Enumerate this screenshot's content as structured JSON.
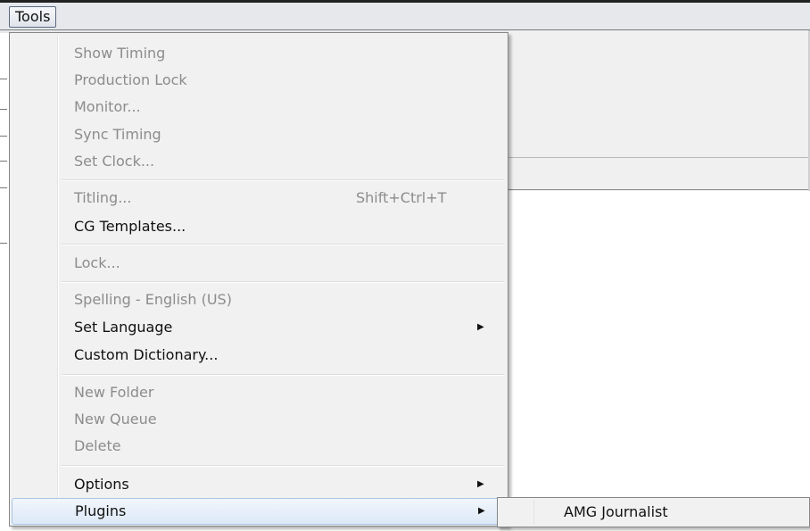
{
  "menubar": {
    "tools_label": "Tools"
  },
  "menu": {
    "groups": [
      [
        {
          "label": "Show Timing",
          "enabled": false
        },
        {
          "label": "Production Lock",
          "enabled": false
        },
        {
          "label": "Monitor...",
          "enabled": false
        },
        {
          "label": "Sync Timing",
          "enabled": false
        },
        {
          "label": "Set Clock...",
          "enabled": false
        }
      ],
      [
        {
          "label": "Titling...",
          "shortcut": "Shift+Ctrl+T",
          "enabled": false
        },
        {
          "label": "CG Templates...",
          "enabled": true
        }
      ],
      [
        {
          "label": "Lock...",
          "enabled": false
        }
      ],
      [
        {
          "label": "Spelling - English (US)",
          "enabled": false
        },
        {
          "label": "Set Language",
          "enabled": true,
          "submenu_arrow": "▶"
        },
        {
          "label": "Custom Dictionary...",
          "enabled": true
        }
      ],
      [
        {
          "label": "New Folder",
          "enabled": false
        },
        {
          "label": "New Queue",
          "enabled": false
        },
        {
          "label": "Delete",
          "enabled": false
        }
      ],
      [
        {
          "label": "Options",
          "enabled": true,
          "submenu_arrow": "▶"
        },
        {
          "label": "Plugins",
          "enabled": true,
          "submenu_arrow": "▶",
          "highlighted": true
        }
      ]
    ]
  },
  "submenu": {
    "items": [
      {
        "label": "AMG Journalist"
      }
    ]
  },
  "colors": {
    "highlight": "#dde9f7",
    "highlight_border": "#a8c4e6",
    "disabled_text": "#8c8c8c"
  }
}
